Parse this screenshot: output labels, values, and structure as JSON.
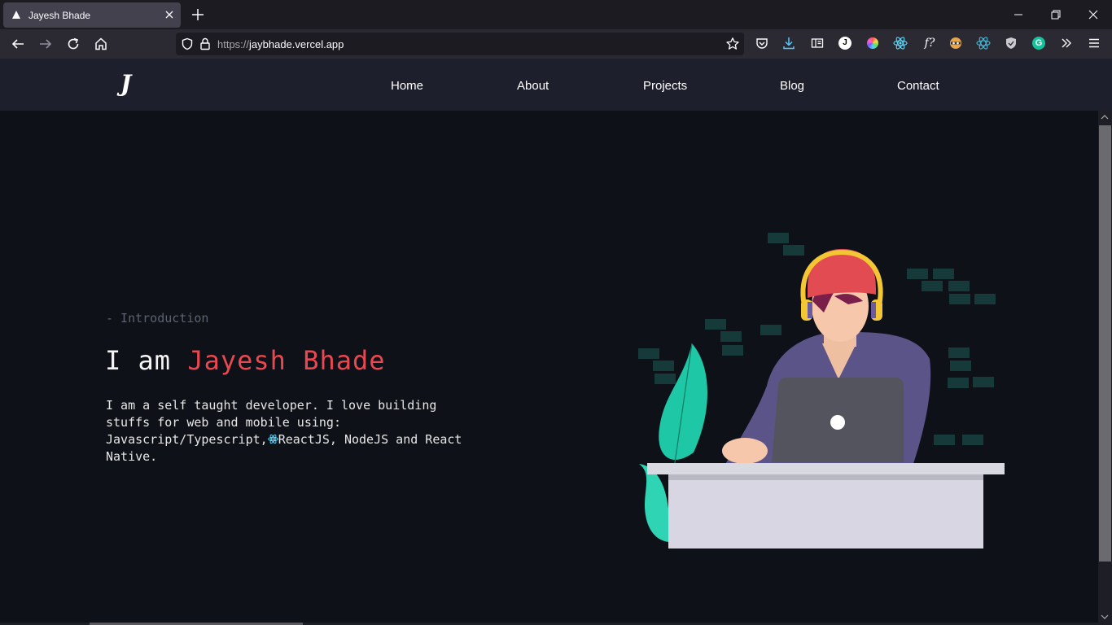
{
  "browser": {
    "tab_title": "Jayesh Bhade",
    "url_protocol": "https://",
    "url_host": "jaybhade.vercel.app",
    "extension_icons": [
      "pocket-icon",
      "download-icon",
      "reader-view-icon",
      "j-extension-icon",
      "color-wheel-icon",
      "react-devtools-icon",
      "font-finder-icon",
      "privacy-badger-icon",
      "redux-devtools-icon",
      "shield-icon",
      "grammarly-icon",
      "overflow-menu-icon",
      "hamburger-menu-icon"
    ],
    "ext_j_letter": "J",
    "ext_font_text": "f?",
    "ext_grammarly_letter": "G"
  },
  "site": {
    "logo": "J",
    "nav": [
      "Home",
      "About",
      "Projects",
      "Blog",
      "Contact"
    ],
    "hero": {
      "intro_label": "- Introduction",
      "headline_prefix": "I am ",
      "headline_name": "Jayesh Bhade",
      "description_line1": "I am a self taught developer. I love building stuffs for web and mobile using: Javascript/Typescript,",
      "description_line2": "ReactJS, NodeJS and React Native."
    }
  },
  "colors": {
    "accent": "#e8484f",
    "header_bg": "#1e1f2d",
    "page_bg": "#0e1117",
    "react": "#61dafb"
  }
}
